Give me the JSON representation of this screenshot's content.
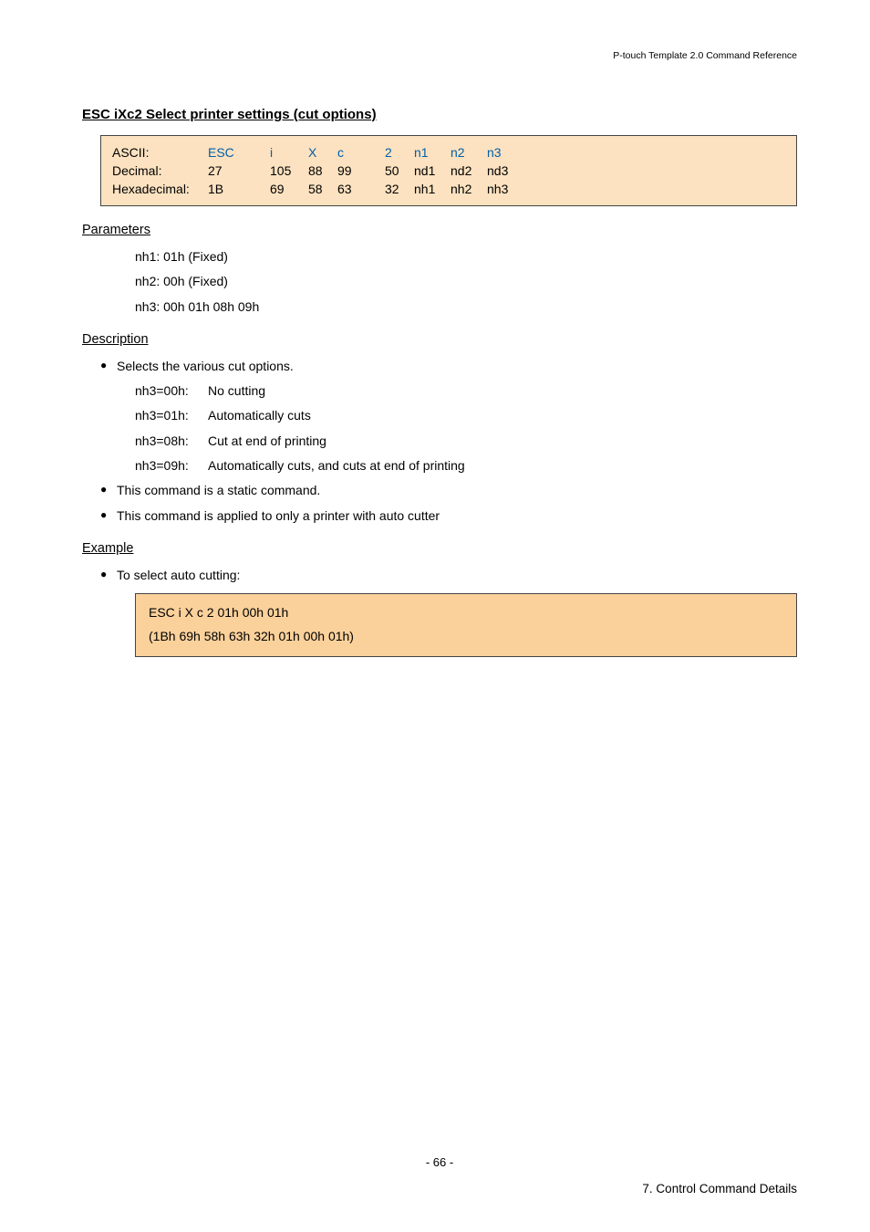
{
  "doc_header": "P-touch Template 2.0 Command Reference",
  "section_title": "ESC iXc2   Select printer settings (cut options)",
  "code_table": {
    "rows": [
      {
        "label": "ASCII:",
        "c1": "ESC",
        "c2": "i",
        "c3": "X",
        "c4": "c",
        "c5": "2",
        "c6": "n1",
        "c7": "n2",
        "c8": "n3",
        "blue": true
      },
      {
        "label": "Decimal:",
        "c1": "27",
        "c2": "105",
        "c3": "88",
        "c4": "99",
        "c5": "50",
        "c6": "nd1",
        "c7": "nd2",
        "c8": "nd3",
        "blue": false
      },
      {
        "label": "Hexadecimal:",
        "c1": "1B",
        "c2": "69",
        "c3": "58",
        "c4": "63",
        "c5": "32",
        "c6": "nh1",
        "c7": "nh2",
        "c8": "nh3",
        "blue": false
      }
    ]
  },
  "parameters_heading": "Parameters",
  "parameters": [
    "nh1: 01h (Fixed)",
    "nh2: 00h (Fixed)",
    "nh3: 00h 01h 08h 09h"
  ],
  "description_heading": "Description",
  "desc_bullet_1": "Selects the various cut options.",
  "desc_rows": [
    {
      "k": "nh3=00h:",
      "v": "No cutting"
    },
    {
      "k": "nh3=01h:",
      "v": "Automatically cuts"
    },
    {
      "k": "nh3=08h:",
      "v": "Cut at end of printing"
    },
    {
      "k": "nh3=09h:",
      "v": "Automatically cuts, and cuts at end of printing"
    }
  ],
  "desc_bullet_2": "This command is a static command.",
  "desc_bullet_3": "This command is applied to only a printer with auto cutter",
  "example_heading": "Example",
  "example_bullet": "To select auto cutting:",
  "example_lines": [
    "ESC i X c 2 01h 00h 01h",
    "(1Bh 69h 58h 63h 32h 01h 00h 01h)"
  ],
  "page_number": "- 66 -",
  "footer_right": "7. Control Command Details",
  "bullet_char": "●"
}
